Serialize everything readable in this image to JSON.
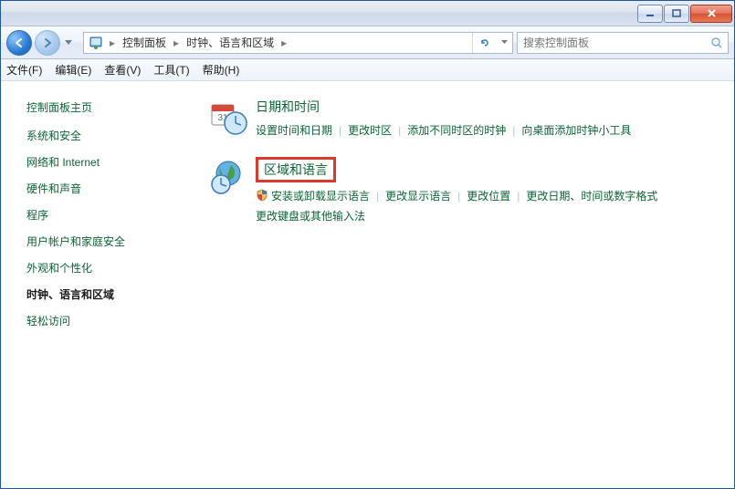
{
  "titlebar": {},
  "nav": {
    "breadcrumb": [
      "控制面板",
      "时钟、语言和区域"
    ],
    "search_placeholder": "搜索控制面板"
  },
  "menubar": [
    "文件(F)",
    "编辑(E)",
    "查看(V)",
    "工具(T)",
    "帮助(H)"
  ],
  "sidebar": {
    "title": "控制面板主页",
    "items": [
      {
        "label": "系统和安全"
      },
      {
        "label": "网络和 Internet"
      },
      {
        "label": "硬件和声音"
      },
      {
        "label": "程序"
      },
      {
        "label": "用户帐户和家庭安全"
      },
      {
        "label": "外观和个性化"
      },
      {
        "label": "时钟、语言和区域",
        "current": true
      },
      {
        "label": "轻松访问"
      }
    ]
  },
  "content": {
    "categories": [
      {
        "title": "日期和时间",
        "links": [
          "设置时间和日期",
          "更改时区",
          "添加不同时区的时钟",
          "向桌面添加时钟小工具"
        ]
      },
      {
        "title": "区域和语言",
        "highlight": true,
        "shield_on_first": true,
        "links": [
          "安装或卸载显示语言",
          "更改显示语言",
          "更改位置",
          "更改日期、时间或数字格式",
          "更改键盘或其他输入法"
        ]
      }
    ]
  }
}
